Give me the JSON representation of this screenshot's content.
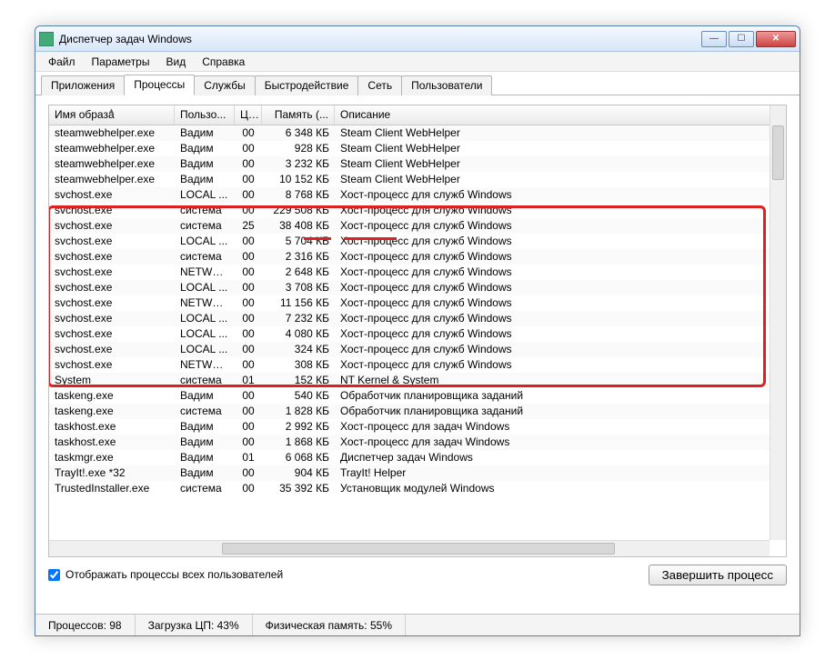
{
  "window": {
    "title": "Диспетчер задач Windows"
  },
  "menu": {
    "file": "Файл",
    "params": "Параметры",
    "view": "Вид",
    "help": "Справка"
  },
  "tabs": [
    {
      "label": "Приложения"
    },
    {
      "label": "Процессы"
    },
    {
      "label": "Службы"
    },
    {
      "label": "Быстродействие"
    },
    {
      "label": "Сеть"
    },
    {
      "label": "Пользователи"
    }
  ],
  "columns": {
    "image": "Имя образа",
    "user": "Пользо...",
    "cpu": "ЦП",
    "memory": "Память (...",
    "desc": "Описание"
  },
  "rows": [
    {
      "name": "steamwebhelper.exe",
      "user": "Вадим",
      "cpu": "00",
      "mem": "6 348 КБ",
      "desc": "Steam Client WebHelper"
    },
    {
      "name": "steamwebhelper.exe",
      "user": "Вадим",
      "cpu": "00",
      "mem": "928 КБ",
      "desc": "Steam Client WebHelper"
    },
    {
      "name": "steamwebhelper.exe",
      "user": "Вадим",
      "cpu": "00",
      "mem": "3 232 КБ",
      "desc": "Steam Client WebHelper"
    },
    {
      "name": "steamwebhelper.exe",
      "user": "Вадим",
      "cpu": "00",
      "mem": "10 152 КБ",
      "desc": "Steam Client WebHelper"
    },
    {
      "name": "svchost.exe",
      "user": "LOCAL ...",
      "cpu": "00",
      "mem": "8 768 КБ",
      "desc": "Хост-процесс для служб Windows"
    },
    {
      "name": "svchost.exe",
      "user": "система",
      "cpu": "00",
      "mem": "229 508 КБ",
      "desc": "Хост-процесс для служб Windows"
    },
    {
      "name": "svchost.exe",
      "user": "система",
      "cpu": "25",
      "mem": "38 408 КБ",
      "desc": "Хост-процесс для служб Windows"
    },
    {
      "name": "svchost.exe",
      "user": "LOCAL ...",
      "cpu": "00",
      "mem": "5 704 КБ",
      "desc": "Хост-процесс для служб Windows"
    },
    {
      "name": "svchost.exe",
      "user": "система",
      "cpu": "00",
      "mem": "2 316 КБ",
      "desc": "Хост-процесс для служб Windows"
    },
    {
      "name": "svchost.exe",
      "user": "NETWO...",
      "cpu": "00",
      "mem": "2 648 КБ",
      "desc": "Хост-процесс для служб Windows"
    },
    {
      "name": "svchost.exe",
      "user": "LOCAL ...",
      "cpu": "00",
      "mem": "3 708 КБ",
      "desc": "Хост-процесс для служб Windows"
    },
    {
      "name": "svchost.exe",
      "user": "NETWO...",
      "cpu": "00",
      "mem": "11 156 КБ",
      "desc": "Хост-процесс для служб Windows"
    },
    {
      "name": "svchost.exe",
      "user": "LOCAL ...",
      "cpu": "00",
      "mem": "7 232 КБ",
      "desc": "Хост-процесс для служб Windows"
    },
    {
      "name": "svchost.exe",
      "user": "LOCAL ...",
      "cpu": "00",
      "mem": "4 080 КБ",
      "desc": "Хост-процесс для служб Windows"
    },
    {
      "name": "svchost.exe",
      "user": "LOCAL ...",
      "cpu": "00",
      "mem": "324 КБ",
      "desc": "Хост-процесс для служб Windows"
    },
    {
      "name": "svchost.exe",
      "user": "NETWO...",
      "cpu": "00",
      "mem": "308 КБ",
      "desc": "Хост-процесс для служб Windows"
    },
    {
      "name": "System",
      "user": "система",
      "cpu": "01",
      "mem": "152 КБ",
      "desc": "NT Kernel & System"
    },
    {
      "name": "taskeng.exe",
      "user": "Вадим",
      "cpu": "00",
      "mem": "540 КБ",
      "desc": "Обработчик планировщика заданий"
    },
    {
      "name": "taskeng.exe",
      "user": "система",
      "cpu": "00",
      "mem": "1 828 КБ",
      "desc": "Обработчик планировщика заданий"
    },
    {
      "name": "taskhost.exe",
      "user": "Вадим",
      "cpu": "00",
      "mem": "2 992 КБ",
      "desc": "Хост-процесс для задач Windows"
    },
    {
      "name": "taskhost.exe",
      "user": "Вадим",
      "cpu": "00",
      "mem": "1 868 КБ",
      "desc": "Хост-процесс для задач Windows"
    },
    {
      "name": "taskmgr.exe",
      "user": "Вадим",
      "cpu": "01",
      "mem": "6 068 КБ",
      "desc": "Диспетчер задач Windows"
    },
    {
      "name": "TrayIt!.exe *32",
      "user": "Вадим",
      "cpu": "00",
      "mem": "904 КБ",
      "desc": "TrayIt! Helper"
    },
    {
      "name": "TrustedInstaller.exe",
      "user": "система",
      "cpu": "00",
      "mem": "35 392 КБ",
      "desc": "Установщик модулей Windows"
    }
  ],
  "checkbox": {
    "label": "Отображать процессы всех пользователей"
  },
  "button": {
    "end": "Завершить процесс"
  },
  "status": {
    "processes": "Процессов: 98",
    "cpu": "Загрузка ЦП: 43%",
    "mem": "Физическая память: 55%"
  }
}
